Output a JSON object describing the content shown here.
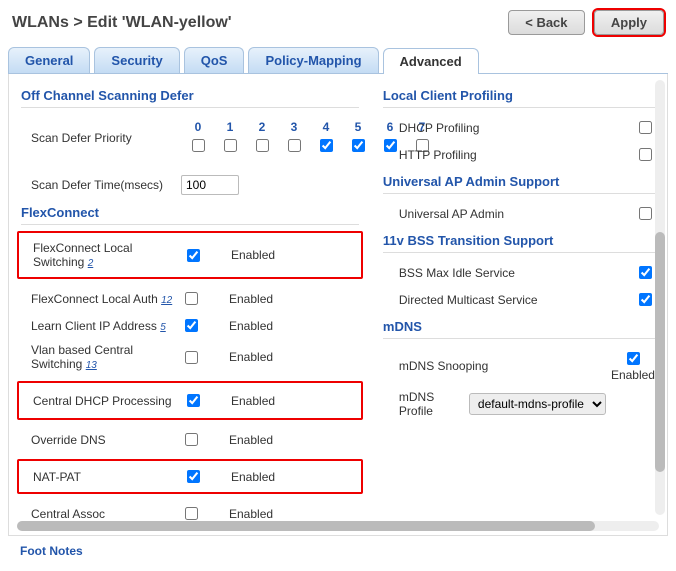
{
  "header": {
    "title": "WLANs > Edit  'WLAN-yellow'",
    "back": "< Back",
    "apply": "Apply"
  },
  "tabs": {
    "general": "General",
    "security": "Security",
    "qos": "QoS",
    "policy": "Policy-Mapping",
    "advanced": "Advanced"
  },
  "left": {
    "offchan_h": "Off Channel Scanning Defer",
    "defer_priority_label": "Scan Defer Priority",
    "priorities": [
      "0",
      "1",
      "2",
      "3",
      "4",
      "5",
      "6",
      "7"
    ],
    "defer_time_label": "Scan Defer Time(msecs)",
    "defer_time_value": "100",
    "flex_h": "FlexConnect",
    "flex_local_sw": "FlexConnect Local Switching",
    "flex_local_sw_fn": "2",
    "flex_local_auth": "FlexConnect Local Auth",
    "flex_local_auth_fn": "12",
    "learn_ip": "Learn Client IP Address",
    "learn_ip_fn": "5",
    "vlan_central": "Vlan based Central Switching",
    "vlan_central_fn": "13",
    "central_dhcp": "Central DHCP Processing",
    "override_dns": "Override DNS",
    "nat_pat": "NAT-PAT",
    "central_assoc": "Central Assoc",
    "enabled_lbl": "Enabled"
  },
  "right": {
    "local_profiling_h": "Local Client Profiling",
    "dhcp_profiling": "DHCP Profiling",
    "http_profiling": "HTTP Profiling",
    "univ_ap_h": "Universal AP Admin Support",
    "univ_ap": "Universal AP Admin",
    "bss_h": "11v BSS Transition Support",
    "bss_idle": "BSS Max Idle Service",
    "directed_mc": "Directed Multicast Service",
    "mdns_h": "mDNS",
    "mdns_snooping": "mDNS Snooping",
    "mdns_profile_label": "mDNS Profile",
    "mdns_profile_value": "default-mdns-profile",
    "enabled_lbl": "Enabled"
  },
  "footnotes": "Foot Notes"
}
